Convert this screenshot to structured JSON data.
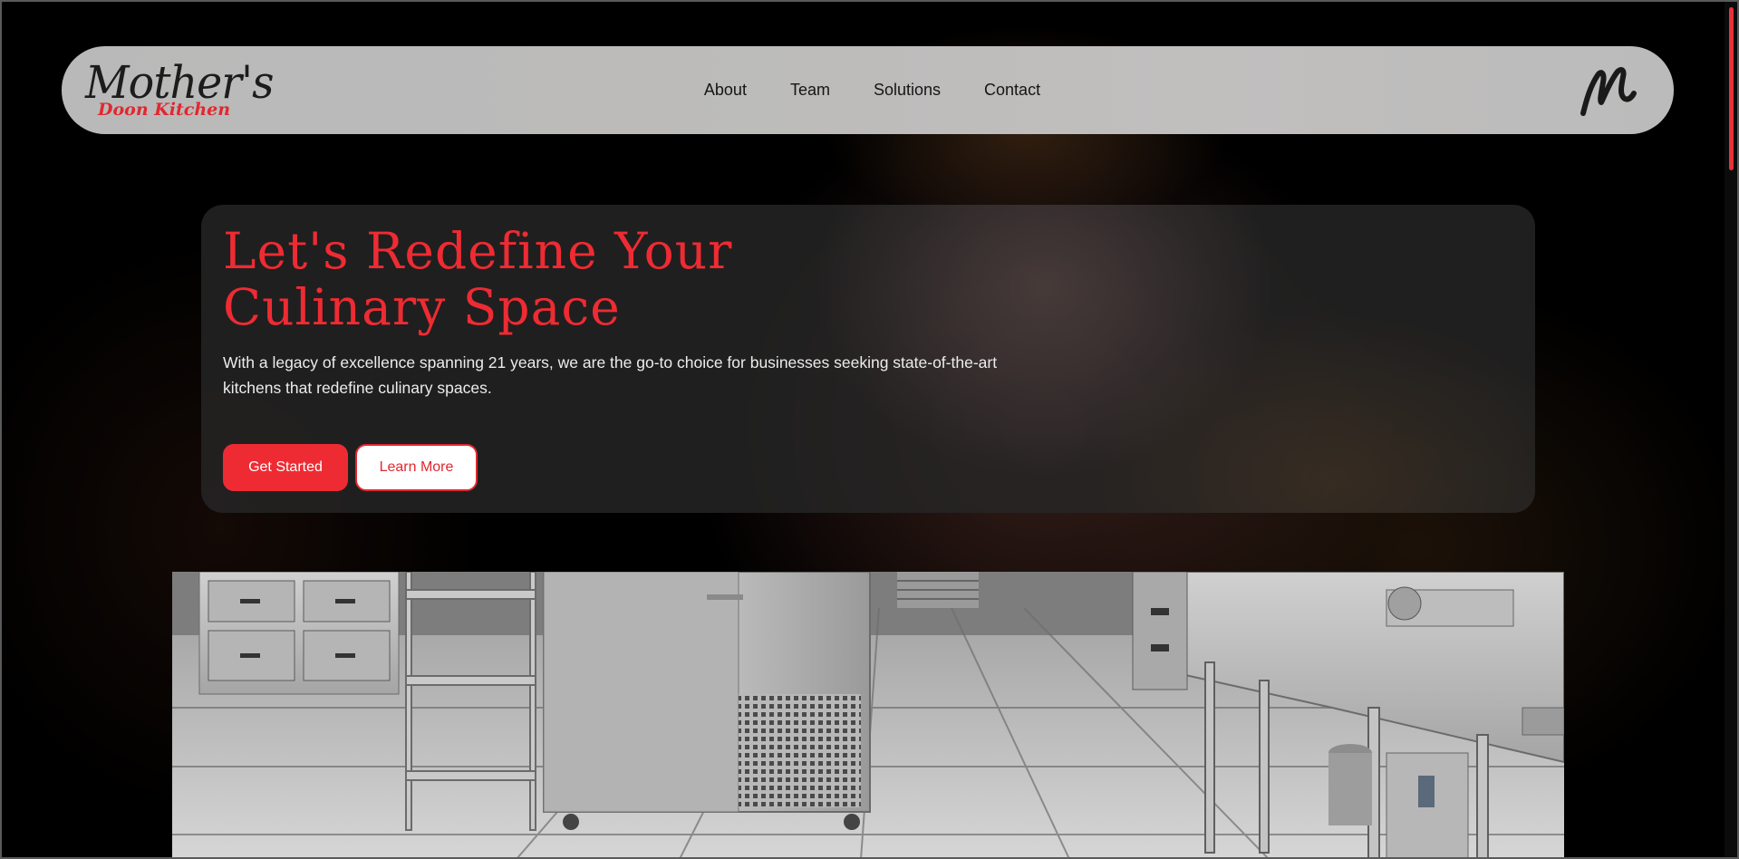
{
  "brand": {
    "logo_main": "Mother's",
    "logo_sub": "Doon Kitchen",
    "mark": "M"
  },
  "nav": {
    "items": [
      "About",
      "Team",
      "Solutions",
      "Contact"
    ]
  },
  "hero": {
    "title": "Let's Redefine Your Culinary Space",
    "description": "With a legacy of excellence spanning 21 years, we are the go-to choice for businesses seeking state-of-the-art kitchens that redefine culinary spaces.",
    "primary_button": "Get Started",
    "secondary_button": "Learn More"
  },
  "colors": {
    "accent": "#ee2b33",
    "background": "#000000",
    "navbar": "#bdbcbb",
    "card": "#262626"
  },
  "icons": {
    "brand_mark": "m-monogram-icon",
    "hero_image": "commercial-kitchen-photo"
  }
}
